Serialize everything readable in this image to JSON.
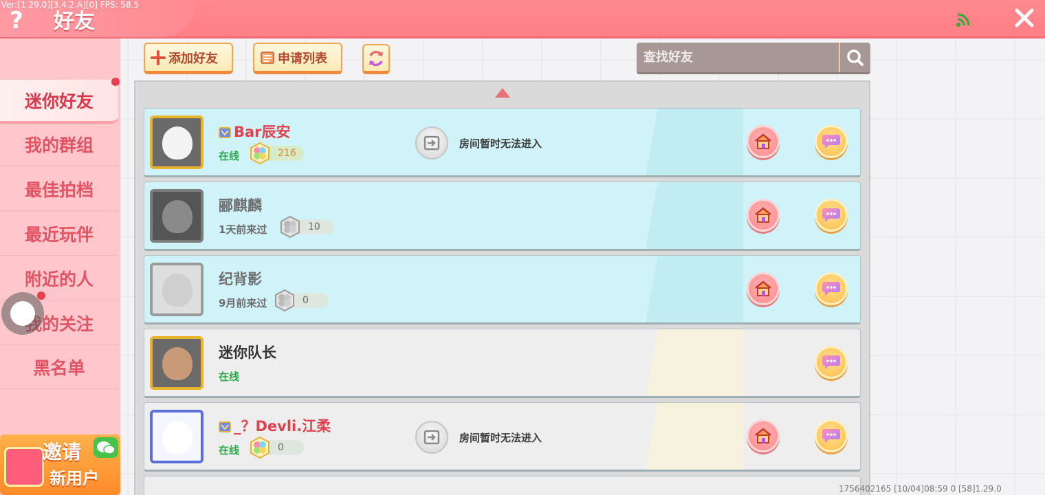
{
  "debug": "Ver:[1.29.0][3.4.2.A][0] FPS: 58.5",
  "header": {
    "title": "好友",
    "help_icon": "question-mark-icon",
    "close_icon": "close-icon",
    "signal_icon": "wifi-signal-icon"
  },
  "sidebar": {
    "items": [
      {
        "label": "迷你好友",
        "active": true,
        "has_dot": true
      },
      {
        "label": "我的群组",
        "active": false,
        "has_dot": false
      },
      {
        "label": "最佳拍档",
        "active": false,
        "has_dot": false
      },
      {
        "label": "最近玩伴",
        "active": false,
        "has_dot": false
      },
      {
        "label": "附近的人",
        "active": false,
        "has_dot": true
      },
      {
        "label": "我的关注",
        "active": false,
        "has_dot": false
      },
      {
        "label": "黑名单",
        "active": false,
        "has_dot": false
      }
    ],
    "invite": {
      "line1": "邀请",
      "line2": "新用户",
      "icon": "wechat-icon"
    }
  },
  "toolbar": {
    "add_friend": "添加好友",
    "apply_list": "申请列表",
    "refresh_icon": "refresh-icon",
    "search_placeholder": "查找好友"
  },
  "friends": [
    {
      "name": "Bar辰安",
      "vip": true,
      "status": "在线",
      "online": true,
      "level": "216",
      "room_status": "房间暂时无法进入",
      "home": true,
      "theme": "cyan"
    },
    {
      "name": "郦麒麟",
      "vip": false,
      "status": "1天前来过",
      "online": false,
      "level": "10",
      "room_status": "",
      "home": true,
      "theme": "cyan"
    },
    {
      "name": "纪背影",
      "vip": false,
      "status": "9月前来过",
      "online": false,
      "level": "0",
      "room_status": "",
      "home": true,
      "theme": "cyan"
    },
    {
      "name": "迷你队长",
      "vip": false,
      "status": "在线",
      "online": true,
      "level": "",
      "room_status": "",
      "home": false,
      "theme": "gray"
    },
    {
      "name": "_？Devli.江柔",
      "vip": true,
      "status": "在线",
      "online": true,
      "level": "0",
      "room_status": "房间暂时无法进入",
      "home": true,
      "theme": "gray"
    }
  ],
  "footer": {
    "info": "1756402165    [10/04]08:59 0    [58]1.29.0"
  },
  "colors": {
    "header": "#ff8087",
    "sidebar": "#ffc7cc",
    "accent_red": "#e0424d",
    "online_green": "#2aa84a"
  }
}
